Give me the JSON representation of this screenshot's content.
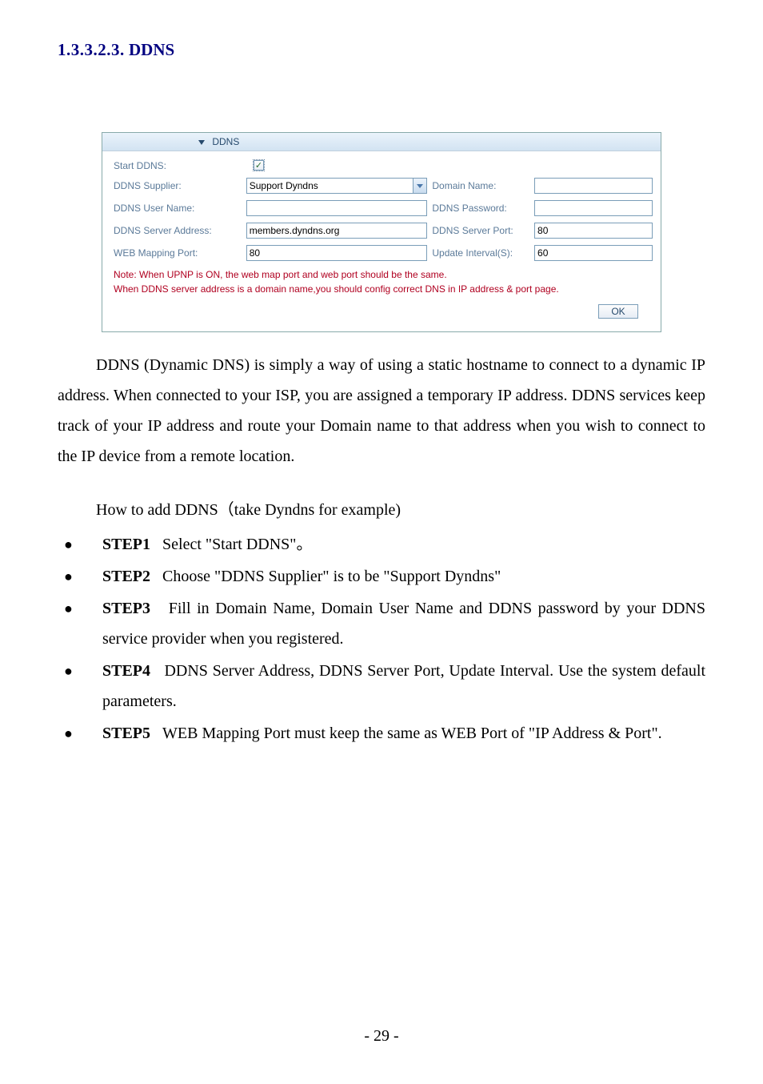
{
  "heading": {
    "number": "1.3.3.2.3.",
    "title": "DDNS"
  },
  "panel": {
    "title": "DDNS",
    "rows": {
      "startDdns": {
        "label": "Start DDNS:",
        "checked": "✓"
      },
      "supplier": {
        "label": "DDNS Supplier:",
        "value": "Support Dyndns"
      },
      "domainName": {
        "label": "Domain Name:",
        "value": ""
      },
      "userName": {
        "label": "DDNS User Name:",
        "value": ""
      },
      "password": {
        "label": "DDNS Password:",
        "value": ""
      },
      "serverAddress": {
        "label": "DDNS Server Address:",
        "value": "members.dyndns.org"
      },
      "serverPort": {
        "label": "DDNS Server Port:",
        "value": "80"
      },
      "webMapPort": {
        "label": "WEB Mapping Port:",
        "value": "80"
      },
      "updateInterval": {
        "label": "Update Interval(S):",
        "value": "60"
      }
    },
    "note1": "Note: When UPNP is ON, the web map port and web port should be the same.",
    "note2": "When DDNS server address is a domain name,you should config correct DNS in IP address & port page.",
    "okLabel": "OK"
  },
  "paragraph1": "DDNS (Dynamic DNS) is simply a way of using a static hostname to connect to a dynamic IP address. When connected to your ISP, you are assigned a temporary IP address. DDNS services keep track of your IP address and route your Domain name to that address when you wish to connect to the IP device from a remote location.",
  "howto": "How to add DDNS（take Dyndns for example)",
  "steps": [
    {
      "label": "STEP1",
      "text": "Select \"Start DDNS\"。"
    },
    {
      "label": "STEP2",
      "text": "Choose \"DDNS Supplier\" is to be \"Support Dyndns\""
    },
    {
      "label": "STEP3",
      "text": "Fill in Domain Name, Domain User Name and DDNS password by your DDNS service provider when you registered."
    },
    {
      "label": "STEP4",
      "text": "DDNS Server Address, DDNS Server Port, Update Interval. Use the system default parameters."
    },
    {
      "label": "STEP5",
      "text": "WEB Mapping Port must keep the same as WEB Port of \"IP Address & Port\"."
    }
  ],
  "pageNumber": "- 29 -"
}
